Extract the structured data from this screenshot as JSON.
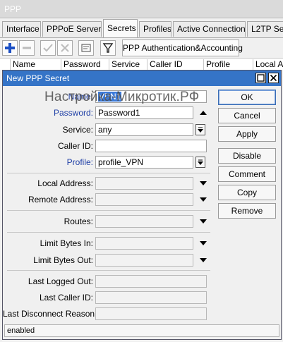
{
  "window": {
    "title": "PPP"
  },
  "tabs": [
    {
      "label": "Interface"
    },
    {
      "label": "PPPoE Servers"
    },
    {
      "label": "Secrets"
    },
    {
      "label": "Profiles"
    },
    {
      "label": "Active Connections"
    },
    {
      "label": "L2TP Se"
    }
  ],
  "toolbar": {
    "add_icon": "plus-icon",
    "remove_icon": "minus-icon",
    "enable_icon": "check-icon",
    "disable_icon": "cross-icon",
    "comment_icon": "note-icon",
    "filter_icon": "filter-icon",
    "auth_button": "PPP Authentication&Accounting"
  },
  "columns": [
    "Name",
    "Password",
    "Service",
    "Caller ID",
    "Profile",
    "Local Ad"
  ],
  "dialog": {
    "title": "New PPP Secret",
    "fields": {
      "name": {
        "label": "Name:",
        "value": "VPN1"
      },
      "password": {
        "label": "Password:",
        "value": "Password1"
      },
      "service": {
        "label": "Service:",
        "value": "any"
      },
      "caller_id": {
        "label": "Caller ID:",
        "value": ""
      },
      "profile": {
        "label": "Profile:",
        "value": "profile_VPN"
      },
      "local_address": {
        "label": "Local Address:",
        "value": ""
      },
      "remote_address": {
        "label": "Remote Address:",
        "value": ""
      },
      "routes": {
        "label": "Routes:",
        "value": ""
      },
      "limit_bytes_in": {
        "label": "Limit Bytes In:",
        "value": ""
      },
      "limit_bytes_out": {
        "label": "Limit Bytes Out:",
        "value": ""
      },
      "last_logged_out": {
        "label": "Last Logged Out:",
        "value": ""
      },
      "last_caller_id": {
        "label": "Last Caller ID:",
        "value": ""
      },
      "last_disconnect_reason": {
        "label": "Last Disconnect Reason:",
        "value": ""
      }
    },
    "buttons": {
      "ok": "OK",
      "cancel": "Cancel",
      "apply": "Apply",
      "disable": "Disable",
      "comment": "Comment",
      "copy": "Copy",
      "remove": "Remove"
    },
    "status": "enabled"
  },
  "watermark": "Настройка-Микротик.РФ",
  "colors": {
    "title_bar": "#3574c7",
    "blue_label": "#1f3fa6",
    "selection": "#3b7ad9",
    "add_icon": "#1b4fc4"
  }
}
